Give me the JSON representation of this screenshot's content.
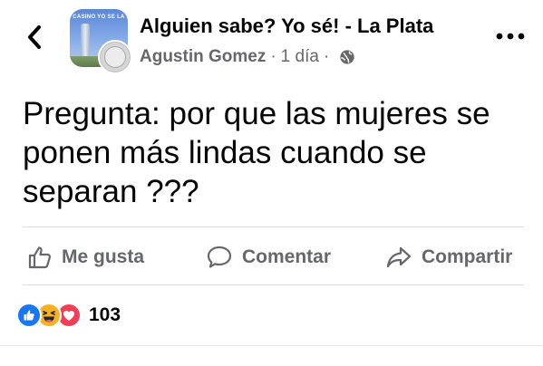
{
  "header": {
    "back_icon": "chevron-left-icon",
    "group_avatar_banner": "CASINO YO SE LA",
    "group_name": "Alguien sabe? Yo sé! - La Plata",
    "author": "Agustin Gomez",
    "separator": "·",
    "time": "1 día",
    "separator2": "·",
    "privacy_icon": "globe-icon",
    "more_icon": "more-horizontal-icon"
  },
  "post": {
    "text": "Pregunta: por que las mujeres se ponen más lindas cuando se separan ???"
  },
  "actions": {
    "like_label": "Me gusta",
    "comment_label": "Comentar",
    "share_label": "Compartir"
  },
  "reactions": {
    "types": [
      "like-icon",
      "haha-icon",
      "love-icon"
    ],
    "count": "103"
  },
  "colors": {
    "text_primary": "#050505",
    "text_secondary": "#65676b",
    "like_blue": "#1877f2",
    "haha_yellow": "#f7b125",
    "love_red": "#f33e58",
    "divider": "#dadde1"
  }
}
